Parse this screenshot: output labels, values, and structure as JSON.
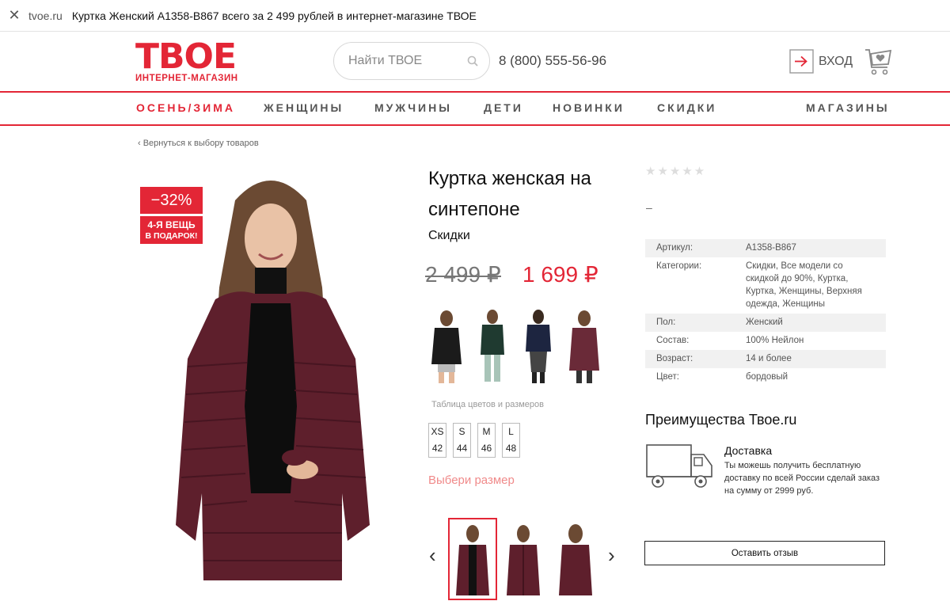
{
  "browser": {
    "domain": "tvoe.ru",
    "title": "Куртка Женский A1358-B867 всего за 2 499  рублей в интернет-магазине ТВОЕ"
  },
  "header": {
    "logo_big": "ТВОЕ",
    "logo_small": "ИНТЕРНЕТ-МАГАЗИН",
    "search_placeholder": "Найти ТВОЕ",
    "phone": "8 (800) 555-56-96",
    "login_label": "ВХОД",
    "brand_color": "#e32636"
  },
  "nav": {
    "items": [
      "ОСЕНЬ/ЗИМА",
      "ЖЕНЩИНЫ",
      "МУЖЧИНЫ",
      "ДЕТИ",
      "НОВИНКИ",
      "СКИДКИ"
    ],
    "stores": "МАГАЗИНЫ"
  },
  "back_link": "‹ Вернуться к выбору товаров",
  "badges": {
    "discount": "−32%",
    "promo_line1": "4-Я ВЕЩЬ",
    "promo_line2": "В ПОДАРОК!"
  },
  "product": {
    "title": "Куртка женская на синтепоне",
    "category": "Скидки",
    "old_price": "2 499 ₽",
    "new_price": "1 699 ₽",
    "color_swatches": [
      "black-jacket",
      "green-jacket",
      "navy-jacket",
      "burgundy-jacket"
    ],
    "size_table_link": "Таблица цветов и размеров",
    "sizes": [
      {
        "label": "XS",
        "num": "42"
      },
      {
        "label": "S",
        "num": "44"
      },
      {
        "label": "M",
        "num": "46"
      },
      {
        "label": "L",
        "num": "48"
      }
    ],
    "choose_size": "Выбери размер",
    "thumbnails": [
      "front",
      "front-zipped",
      "back"
    ]
  },
  "rating": {
    "stars": "★★★★★",
    "value": 0,
    "reviews_dash": "–"
  },
  "attributes": [
    {
      "key": "Артикул:",
      "value": "A1358-B867"
    },
    {
      "key": "Категории:",
      "value": "Скидки, Все модели со скидкой до 90%, Куртка, Куртка, Женщины, Верхняя одежда, Женщины"
    },
    {
      "key": "Пол:",
      "value": "Женский"
    },
    {
      "key": "Состав:",
      "value": "100% Нейлон"
    },
    {
      "key": "Возраст:",
      "value": "14 и более"
    },
    {
      "key": "Цвет:",
      "value": "бордовый"
    }
  ],
  "advantages": {
    "title": "Преимущества Твое.ru",
    "delivery_title": "Доставка",
    "delivery_text": "Ты можешь получить бесплатную доставку по всей России сделай заказ на сумму от 2999 руб."
  },
  "review_button": "Оставить отзыв"
}
